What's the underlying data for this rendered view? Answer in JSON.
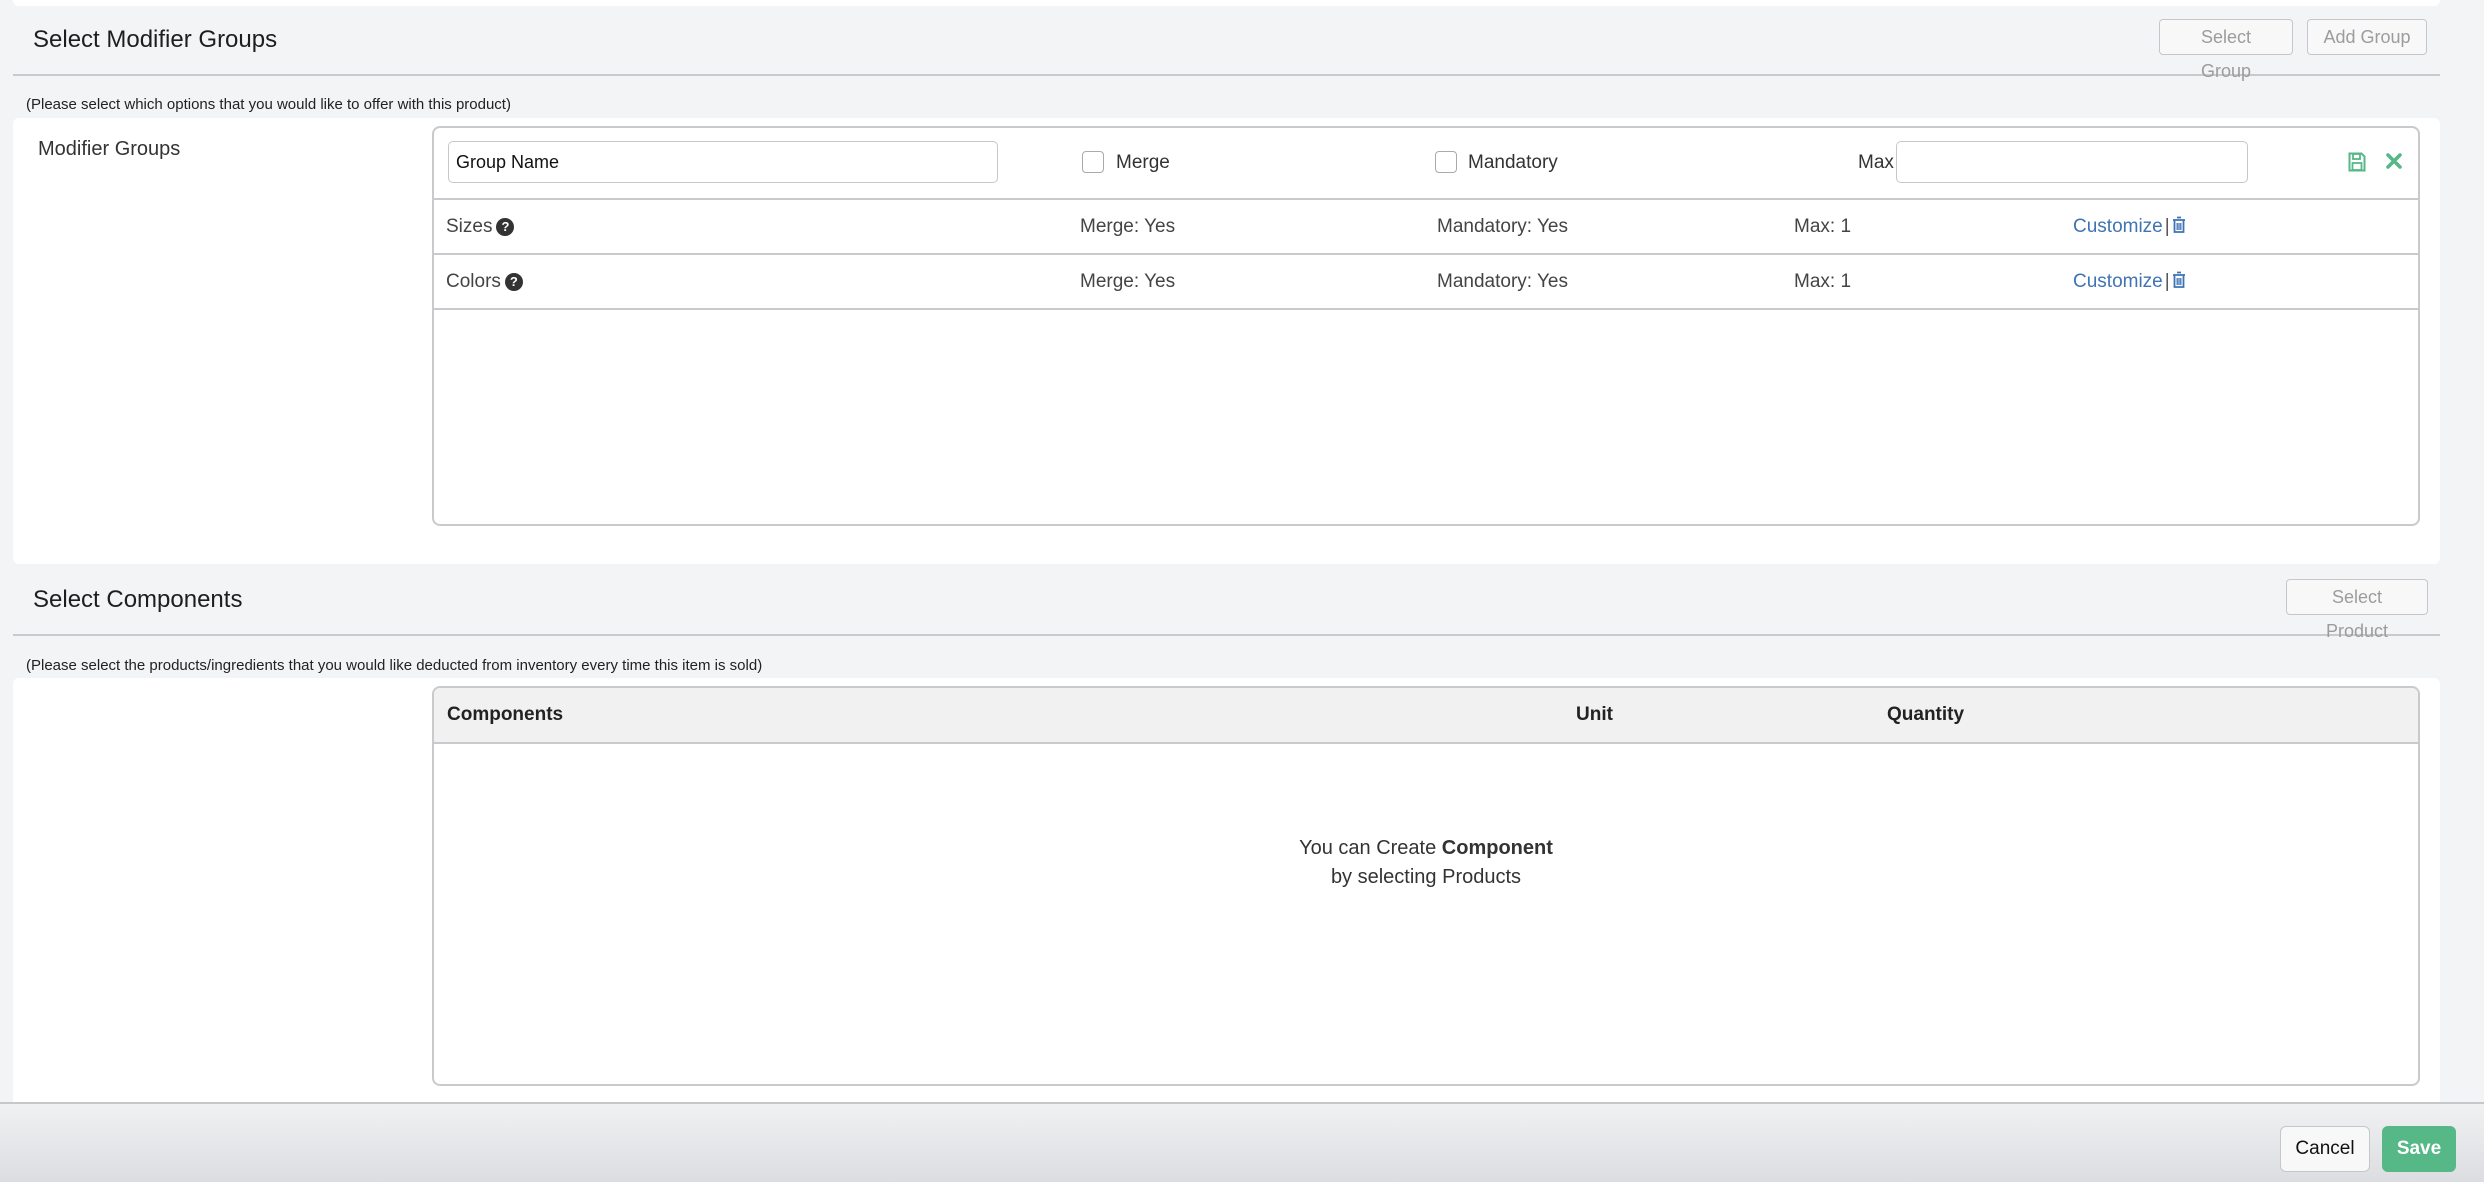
{
  "modifier_section": {
    "title": "Select Modifier Groups",
    "select_group_label": "Select Group",
    "add_group_label": "Add Group",
    "hint": "(Please select which options that you would like to offer with this product)",
    "side_label": "Modifier Groups",
    "edit_row": {
      "group_name_value": "Group Name",
      "merge_label": "Merge",
      "merge_checked": false,
      "mandatory_label": "Mandatory",
      "mandatory_checked": false,
      "max_label": "Max",
      "max_value": "",
      "save_icon": "floppy-disk-icon",
      "cancel_icon": "close-x-icon"
    },
    "groups": [
      {
        "name": "Sizes",
        "merge": "Merge: Yes",
        "mandatory": "Mandatory: Yes",
        "max": "Max: 1",
        "customize": "Customize",
        "separator": "|"
      },
      {
        "name": "Colors",
        "merge": "Merge: Yes",
        "mandatory": "Mandatory: Yes",
        "max": "Max: 1",
        "customize": "Customize",
        "separator": "|"
      }
    ],
    "help_icon_glyph": "?"
  },
  "components_section": {
    "title": "Select Components",
    "select_product_label": "Select Product",
    "hint": "(Please select the products/ingredients that you would like deducted from inventory every time this item is sold)",
    "columns": [
      "Components",
      "Unit",
      "Quantity"
    ],
    "empty_line1_prefix": "You can Create ",
    "empty_line1_bold": "Component",
    "empty_line2": "by selecting Products"
  },
  "footer": {
    "cancel_label": "Cancel",
    "save_label": "Save"
  },
  "colors": {
    "accent_green": "#56b787",
    "link_blue": "#3f74b4"
  }
}
